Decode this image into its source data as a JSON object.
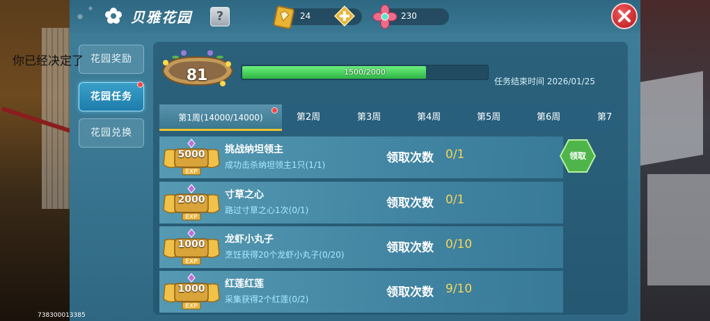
{
  "overlay_text": "你已经决定了",
  "uid": "738300013385",
  "header": {
    "title": "贝雅花园",
    "help_label": "?",
    "currency_gold": "24",
    "currency_gem": "230"
  },
  "nav": {
    "items": [
      {
        "label": "花园奖励",
        "active": false
      },
      {
        "label": "花园任务",
        "active": true,
        "notify": true
      },
      {
        "label": "花园兑换",
        "active": false
      }
    ]
  },
  "level": {
    "value": "81",
    "progress_text": "1500/2000",
    "progress_fraction": 0.75,
    "end_time": "任务结束时间 2026/01/25"
  },
  "tabs": [
    {
      "label": "第1周(14000/14000)",
      "active": true,
      "notify": true
    },
    {
      "label": "第2周"
    },
    {
      "label": "第3周"
    },
    {
      "label": "第4周"
    },
    {
      "label": "第5周"
    },
    {
      "label": "第6周"
    },
    {
      "label": "第7"
    }
  ],
  "tasks": [
    {
      "exp": "5000",
      "exp_label": "EXP",
      "title": "挑战纳坦领主",
      "desc": "成功击杀纳坦领主1只(1/1)",
      "claim_label": "领取次数",
      "claim_count": "0/1",
      "claimable": true
    },
    {
      "exp": "2000",
      "exp_label": "EXP",
      "title": "寸草之心",
      "desc": "路过寸草之心1次(0/1)",
      "claim_label": "领取次数",
      "claim_count": "0/1"
    },
    {
      "exp": "1000",
      "exp_label": "EXP",
      "title": "龙虾小丸子",
      "desc": "烹饪获得20个龙虾小丸子(0/20)",
      "claim_label": "领取次数",
      "claim_count": "0/10"
    },
    {
      "exp": "1000",
      "exp_label": "EXP",
      "title": "红莲红莲",
      "desc": "采集获得2个红莲(0/2)",
      "claim_label": "领取次数",
      "claim_count": "9/10"
    }
  ],
  "claim_button_label": "领取",
  "colors": {
    "accent_gold": "#f2c22c",
    "progress_green": "#3fd45a",
    "close_red": "#d02a2f",
    "claim_green": "#4fb54a"
  }
}
